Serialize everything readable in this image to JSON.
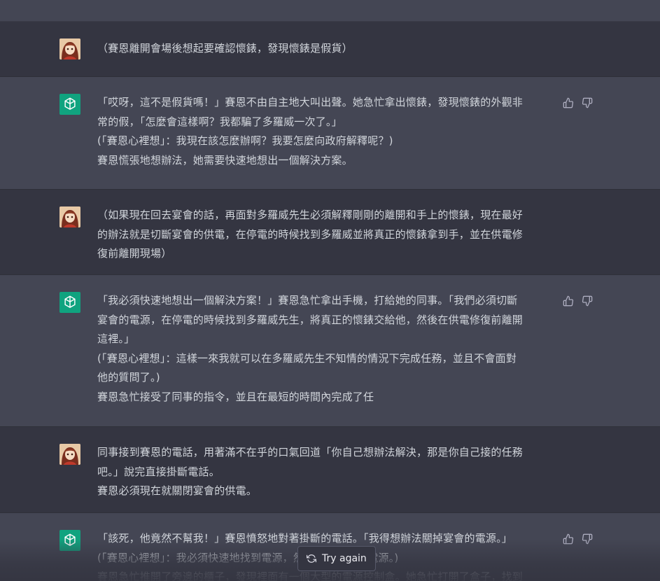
{
  "conversation": {
    "messages": [
      {
        "role": "user",
        "lines": [
          "（賽恩離開會場後想起要確認懷錶，發現懷錶是假貨）"
        ]
      },
      {
        "role": "assistant",
        "lines": [
          "「哎呀，這不是假貨嗎！」賽恩不由自主地大叫出聲。她急忙拿出懷錶，發現懷錶的外觀非",
          "常的假，「怎麼會這樣啊？我都騙了多羅威一次了。」",
          "(「賽恩心裡想」：我現在該怎麼辦啊？我要怎麼向政府解釋呢？)",
          "賽恩慌張地想辦法，她需要快速地想出一個解決方案。"
        ]
      },
      {
        "role": "user",
        "lines": [
          "（如果現在回去宴會的話，再面對多羅威先生必須解釋剛剛的離開和手上的懷錶，現在最好",
          "的辦法就是切斷宴會的供電，在停電的時候找到多羅威並將真正的懷錶拿到手，並在供電修",
          "復前離開現場）"
        ]
      },
      {
        "role": "assistant",
        "lines": [
          "「我必須快速地想出一個解決方案！」賽恩急忙拿出手機，打給她的同事。「我們必須切斷",
          "宴會的電源，在停電的時候找到多羅威先生，將真正的懷錶交給他，然後在供電修復前離開",
          "這裡。」",
          "(「賽恩心裡想」：這樣一來我就可以在多羅威先生不知情的情況下完成任務，並且不會面對",
          "他的質問了。)",
          "賽恩急忙接受了同事的指令，並且在最短的時間內完成了任"
        ]
      },
      {
        "role": "user",
        "lines": [
          "同事接到賽恩的電話，用著滿不在乎的口氣回道「你自己想辦法解決，那是你自己接的任務",
          "吧。」說完直接掛斷電話。",
          "賽恩必須現在就關閉宴會的供電。"
        ]
      },
      {
        "role": "assistant",
        "lines": [
          "「該死，他竟然不幫我！」賽恩憤怒地對著掛斷的電話。「我得想辦法關掉宴會的電源。」",
          "(「賽恩心裡想」：我必須快速地找到電源，然後關掉宴會的電源。)",
          "賽恩急忙推開了旁邊的櫃子，發現裡面有一個大型的電源控制盒。她急忙打開了盒子，找到"
        ]
      }
    ]
  },
  "actions": {
    "try_again_label": "Try again",
    "try_again_icon": "refresh-icon"
  },
  "icons": {
    "thumbs_up": "thumbs-up-icon",
    "thumbs_down": "thumbs-down-icon",
    "assistant_logo": "openai-logo-icon",
    "user_avatar": "user-avatar"
  },
  "colors": {
    "user_bg": "#343541",
    "assistant_bg": "#444654",
    "assistant_avatar": "#10a37f",
    "text": "#d1d5db"
  }
}
